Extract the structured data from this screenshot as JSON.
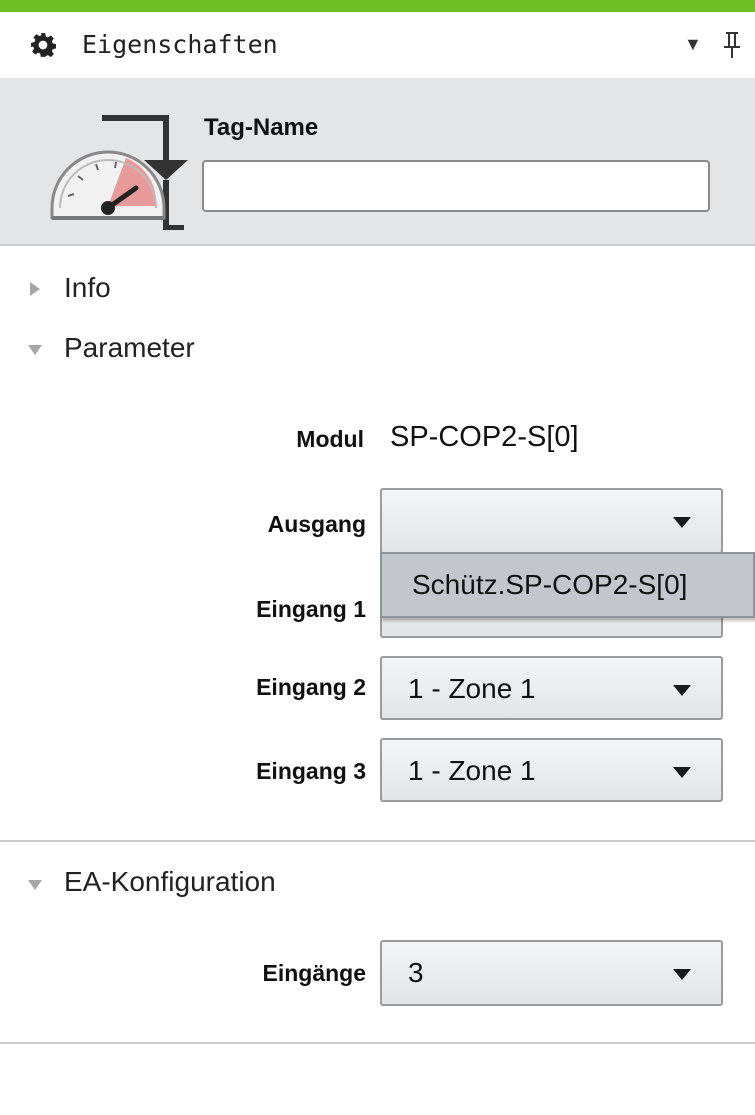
{
  "panel": {
    "title": "Eigenschaften",
    "icons": {
      "settings": "gear-icon",
      "dropdown": "triangle-down-icon",
      "pin": "pin-icon"
    }
  },
  "header": {
    "icon": "gauge-tag-icon",
    "tag_name_label": "Tag-Name",
    "tag_name_value": ""
  },
  "sections": {
    "info": {
      "label": "Info",
      "expanded": false
    },
    "parameter": {
      "label": "Parameter",
      "expanded": true,
      "modul_label": "Modul",
      "modul_value": "SP-COP2-S[0]",
      "ausgang_label": "Ausgang",
      "ausgang_value": "",
      "ausgang_option": "Schütz.SP-COP2-S[0]",
      "eingang1_label": "Eingang 1",
      "eingang2_label": "Eingang 2",
      "eingang2_value": "1 - Zone 1",
      "eingang3_label": "Eingang 3",
      "eingang3_value": "1 - Zone 1"
    },
    "ea_konfiguration": {
      "label": "EA-Konfiguration",
      "expanded": true,
      "eingaenge_label": "Eingänge",
      "eingaenge_value": "3"
    }
  },
  "colors": {
    "accent": "#6cc024",
    "header_bg": "#e4e5e7",
    "popup_bg": "#c3c7cd"
  }
}
